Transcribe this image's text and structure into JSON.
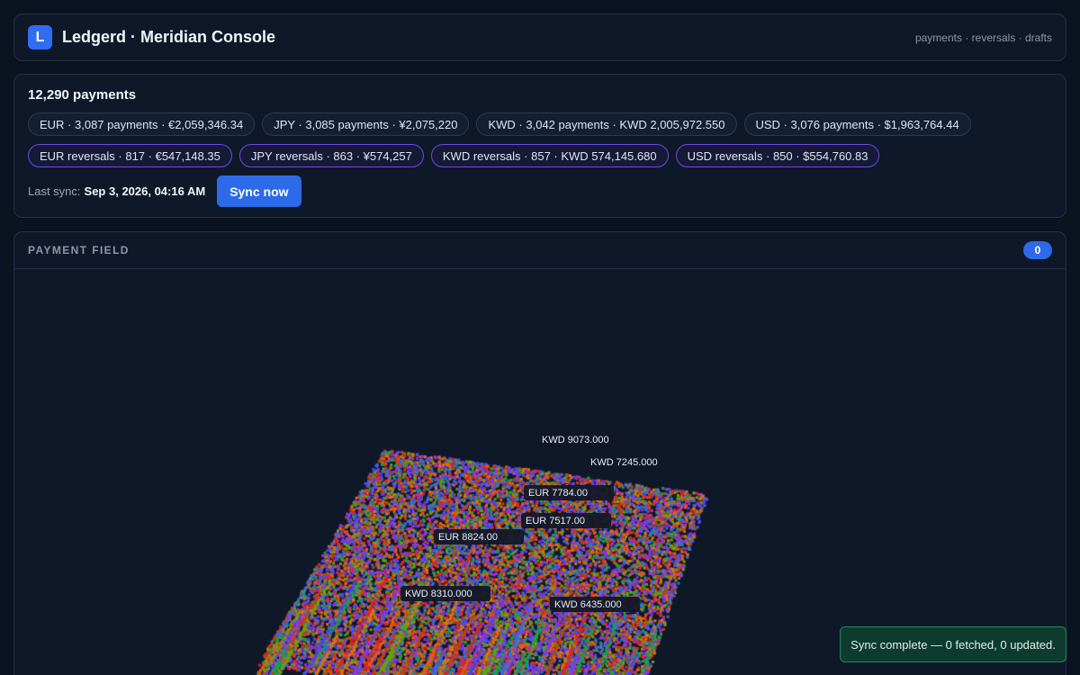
{
  "header": {
    "logo_letter": "L",
    "title": "Ledgerd · Meridian Console",
    "nav": "payments · reversals · drafts"
  },
  "summary": {
    "title": "12,290 payments",
    "payment_chips": [
      "EUR · 3,087 payments · €2,059,346.34",
      "JPY · 3,085 payments · ¥2,075,220",
      "KWD · 3,042 payments · KWD 2,005,972.550",
      "USD · 3,076 payments · $1,963,764.44"
    ],
    "reversal_chips": [
      "EUR reversals · 817 · €547,148.35",
      "JPY reversals · 863 · ¥574,257",
      "KWD reversals · 857 · KWD 574,145.680",
      "USD reversals · 850 · $554,760.83"
    ],
    "last_sync_label": "Last sync:",
    "last_sync_value": "Sep 3, 2026, 04:16 AM",
    "sync_button": "Sync now"
  },
  "field": {
    "title": "PAYMENT FIELD",
    "count": "0",
    "tags": [
      "KWD 9073.000",
      "KWD 7245.000",
      "EUR 7784.00",
      "EUR 7517.00",
      "EUR 8824.00",
      "KWD 8310.000",
      "KWD 6435.000"
    ],
    "palette": [
      "#2f6fe0",
      "#7c3aed",
      "#9333ea",
      "#16a34a",
      "#d97706",
      "#dc2626",
      "#ea580c",
      "#65a30d",
      "#c2410c",
      "#4f46e5"
    ]
  },
  "toast": {
    "message": "Sync complete — 0 fetched, 0 updated."
  }
}
